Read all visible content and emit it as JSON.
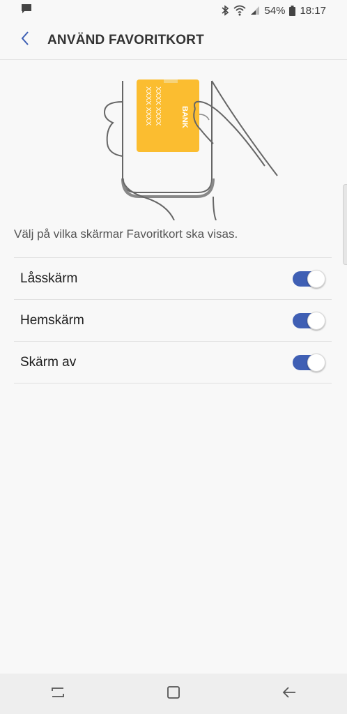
{
  "status_bar": {
    "battery_percent": "54%",
    "time": "18:17",
    "icons": [
      "chat-notification-icon",
      "bluetooth-icon",
      "wifi-icon",
      "signal-icon",
      "battery-icon"
    ]
  },
  "header": {
    "title": "ANVÄND FAVORITKORT",
    "back_icon": "chevron-left-icon"
  },
  "illustration": {
    "card_text_1": "XXXX  XXXX",
    "card_text_2": "XXXX  XXXX",
    "card_brand": "BANK",
    "card_color": "#fbbd30"
  },
  "description": "Välj på vilka skärmar Favoritkort ska visas.",
  "settings": [
    {
      "label": "Låsskärm",
      "enabled": true
    },
    {
      "label": "Hemskärm",
      "enabled": true
    },
    {
      "label": "Skärm av",
      "enabled": true
    }
  ],
  "colors": {
    "accent": "#3f5fb4",
    "back_arrow": "#3d5fb4",
    "background": "#f8f8f8"
  },
  "nav_bar": {
    "icons": [
      "recent-apps-icon",
      "home-icon",
      "back-icon"
    ]
  }
}
